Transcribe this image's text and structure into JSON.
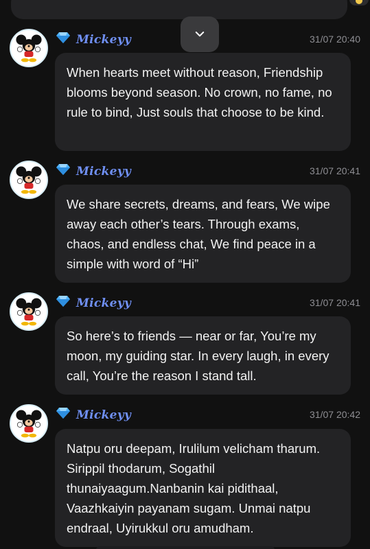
{
  "messages": [
    {
      "sender": "Mickeyy",
      "time": "31/07 20:40",
      "text": "When hearts meet without reason, Friendship blooms beyond season. No crown, no fame, no rule to bind, Just souls that choose to be kind."
    },
    {
      "sender": "Mickeyy",
      "time": "31/07 20:41",
      "text": "We share secrets, dreams, and fears, We wipe away each other’s tears. Through exams, chaos, and endless chat, We find peace in a simple with word of  “Hi”"
    },
    {
      "sender": "Mickeyy",
      "time": "31/07 20:41",
      "text": "So here’s to friends — near or far, You’re my moon, my guiding star. In every laugh, in every call, You’re the reason I stand tall."
    },
    {
      "sender": "Mickeyy",
      "time": "31/07 20:42",
      "text": "Natpu oru deepam, Irulilum velicham tharum. Sirippil thodarum, Sogathil thunaiyaagum.Nanbanin kai pidithaal, Vaazhkaiyin payanam sugam. Unmai natpu endraal, Uyirukkul oru amudham."
    }
  ],
  "icons": {
    "scroll": "chevron-down-icon",
    "badge": "diamond-icon",
    "avatar": "mickey-avatar"
  },
  "colors": {
    "background": "#111111",
    "bubble": "#232325",
    "name": "#6f8ff2",
    "time": "#8e8e93",
    "badge": "#4fb3ff"
  }
}
